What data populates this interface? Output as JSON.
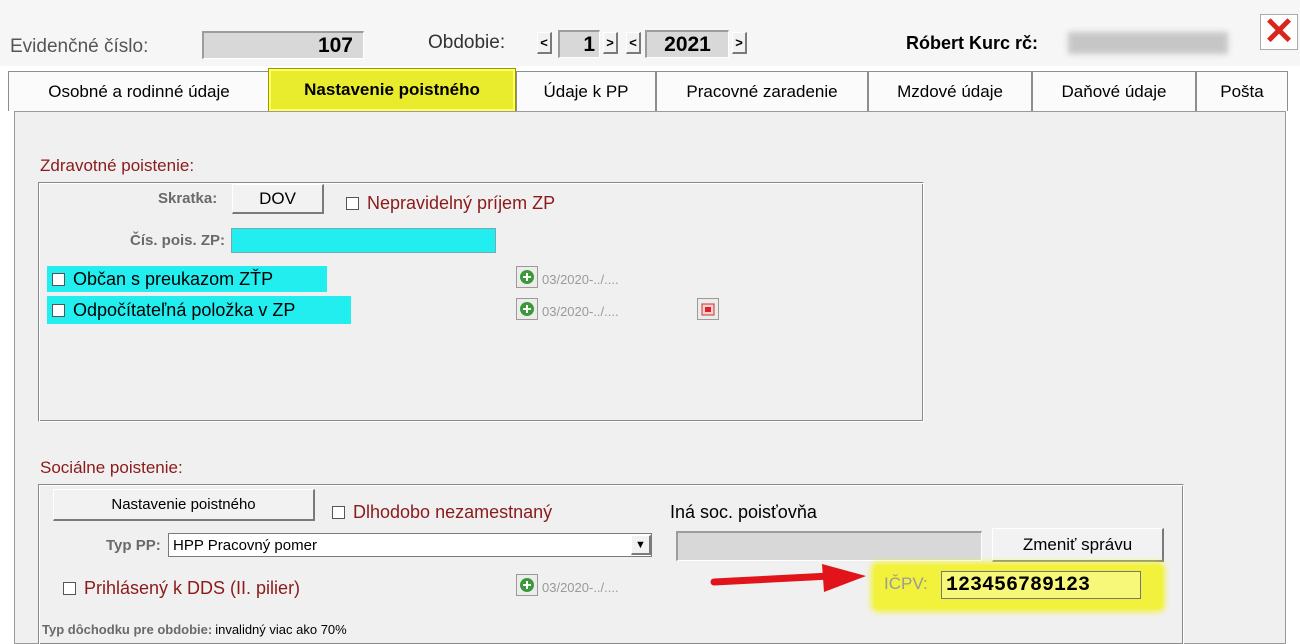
{
  "header": {
    "evid_label": "Evidenčné číslo:",
    "evid_value": "107",
    "obdobie_label": "Obdobie:",
    "month": "1",
    "year": "2021",
    "prev_symbol": "<",
    "next_symbol": ">",
    "employee": "Róbert Kurc rč:",
    "close_symbol": "✕"
  },
  "tabs": [
    {
      "label": "Osobné a rodinné údaje"
    },
    {
      "label": "Nastavenie poistného"
    },
    {
      "label": "Údaje k PP"
    },
    {
      "label": "Pracovné zaradenie"
    },
    {
      "label": "Mzdové údaje"
    },
    {
      "label": "Daňové údaje"
    },
    {
      "label": "Pošta"
    }
  ],
  "health": {
    "title": "Zdravotné poistenie:",
    "skratka_label": "Skratka:",
    "skratka_value": "DOV",
    "irregular_label": "Nepravidelný príjem ZP",
    "cis_label": "Čís. pois. ZP:",
    "cis_value": "",
    "ztp_label": "Občan s preukazom ZŤP",
    "ztp_period": "03/2020-../....",
    "deduct_label": "Odpočítateľná položka v ZP",
    "deduct_period": "03/2020-../...."
  },
  "social": {
    "title": "Sociálne poistenie:",
    "settings_button": "Nastavenie poistného",
    "longterm_label": "Dlhodobo nezamestnaný",
    "other_insurer_label": "Iná soc. poisťovňa",
    "typ_label": "Typ PP:",
    "typ_value": "HPP Pracovný pomer",
    "change_button": "Zmeniť správu",
    "dds_label": "Prihlásený k DDS (II. pilier)",
    "dds_period": "03/2020-../....",
    "icpv_label": "IČPV:",
    "icpv_value": "123456789123",
    "pension_label": "Typ dôchodku pre obdobie:",
    "pension_value": "invalidný viac ako 70%"
  },
  "colors": {
    "tab_active": "#e9ec2c",
    "highlight_cyan": "#22eef0",
    "highlight_yellow": "#f2f23c",
    "arrow_red": "#e0141a",
    "close_red": "#d9261c",
    "label_darkred": "#8b1a1a"
  }
}
